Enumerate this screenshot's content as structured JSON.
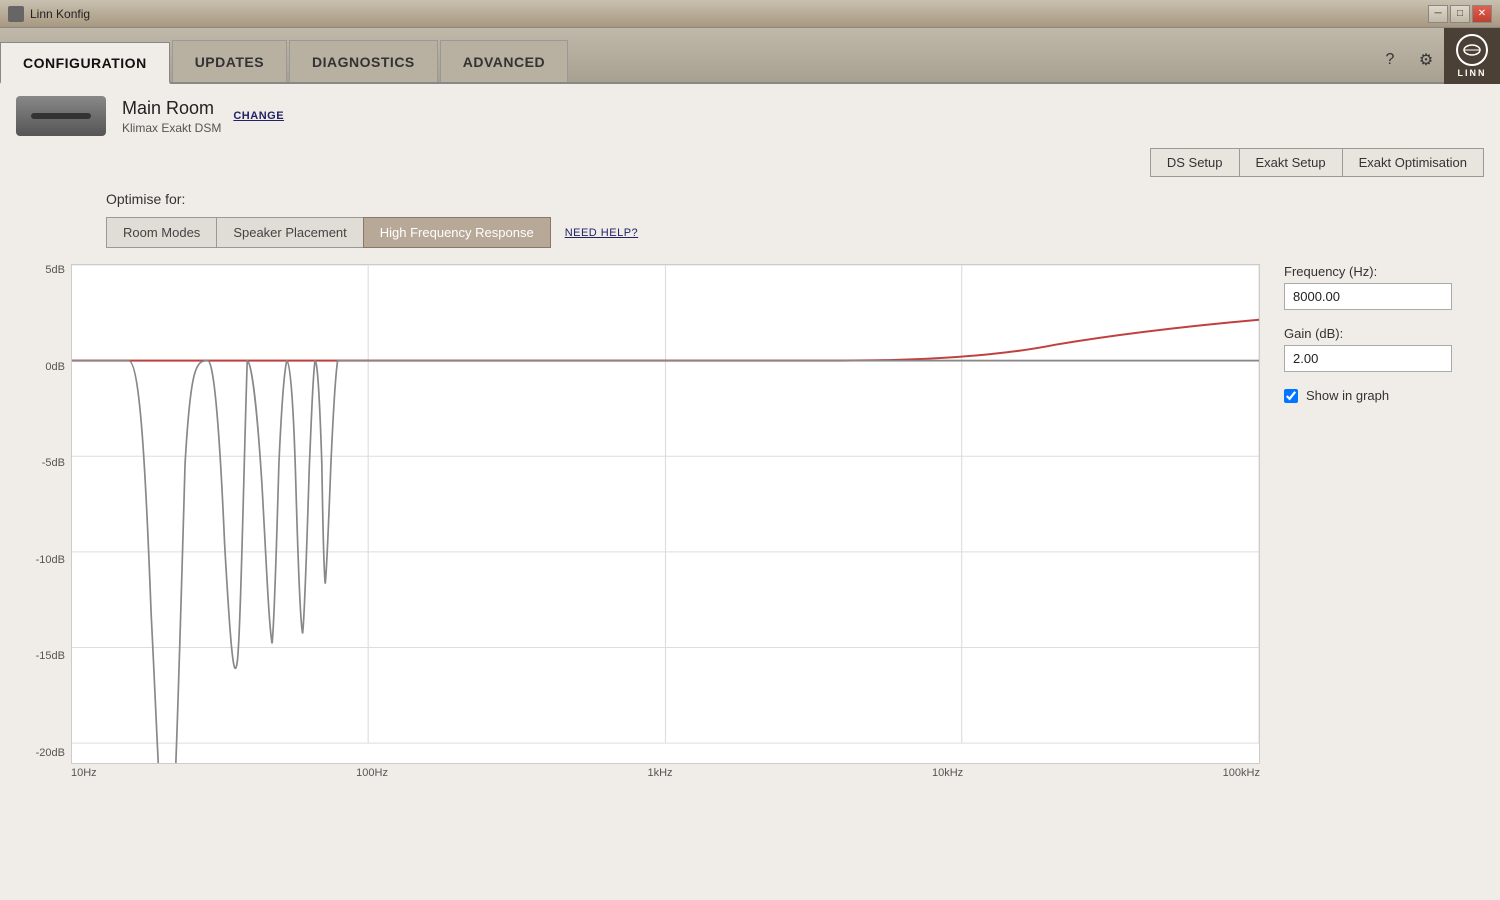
{
  "window": {
    "title": "Linn Konfig",
    "min_label": "─",
    "max_label": "□",
    "close_label": "✕"
  },
  "nav": {
    "tabs": [
      {
        "label": "CONFIGURATION",
        "active": true
      },
      {
        "label": "UPDATES",
        "active": false
      },
      {
        "label": "DIAGNOSTICS",
        "active": false
      },
      {
        "label": "ADVANCED",
        "active": false
      }
    ],
    "help_icon": "?",
    "settings_icon": "⚙",
    "linn_logo": "LINN"
  },
  "device": {
    "name": "Main Room",
    "model": "Klimax Exakt DSM",
    "change_label": "CHANGE"
  },
  "sub_tabs": [
    {
      "label": "DS Setup"
    },
    {
      "label": "Exakt Setup"
    },
    {
      "label": "Exakt Optimisation"
    }
  ],
  "optimise": {
    "label": "Optimise for:"
  },
  "mode_tabs": [
    {
      "label": "Room Modes",
      "active": false
    },
    {
      "label": "Speaker Placement",
      "active": false
    },
    {
      "label": "High Frequency Response",
      "active": true
    }
  ],
  "need_help": "NEED HELP?",
  "chart": {
    "y_labels": [
      "5dB",
      "0dB",
      "-5dB",
      "-10dB",
      "-15dB",
      "-20dB"
    ],
    "x_labels": [
      "10Hz",
      "100Hz",
      "1kHz",
      "10kHz",
      "100kHz"
    ]
  },
  "right_panel": {
    "frequency_label": "Frequency (Hz):",
    "frequency_value": "8000.00",
    "gain_label": "Gain (dB):",
    "gain_value": "2.00",
    "show_in_graph_label": "Show in graph",
    "show_in_graph_checked": true
  }
}
